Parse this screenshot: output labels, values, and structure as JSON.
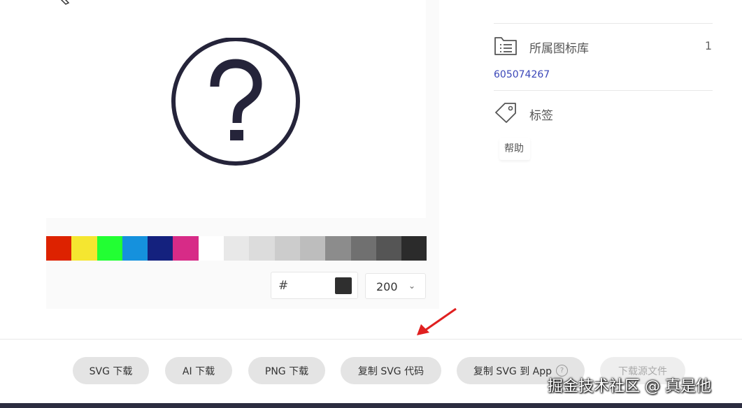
{
  "preview": {
    "icon_name": "question-circle-icon",
    "icon_color": "#25243a"
  },
  "palette": {
    "colors": [
      "#dd2200",
      "#f5e630",
      "#22ff33",
      "#1591dd",
      "#14217e",
      "#d72b87",
      "#ffffff",
      "#e8e8e8",
      "#dcdcdc",
      "#cccccc",
      "#bdbdbd",
      "#8c8c8c",
      "#707070",
      "#555555",
      "#2b2b2b"
    ]
  },
  "color_input": {
    "hash": "#",
    "current_color": "#2f2f2f"
  },
  "size_select": {
    "value": "200"
  },
  "sidebar": {
    "library_label": "所属图标库",
    "library_count": "1",
    "library_id": "605074267",
    "tags_label": "标签",
    "tags": [
      "帮助"
    ]
  },
  "actions": {
    "svg_download": "SVG 下载",
    "ai_download": "AI 下载",
    "png_download": "PNG 下载",
    "copy_svg_code": "复制 SVG 代码",
    "copy_svg_app": "复制 SVG 到 App",
    "download_source": "下载源文件"
  },
  "watermark": "掘金技术社区 @ 真是他",
  "colors": {
    "link": "#3a46b8",
    "arrow": "#e02020",
    "footer_bar": "#2c2d40"
  }
}
